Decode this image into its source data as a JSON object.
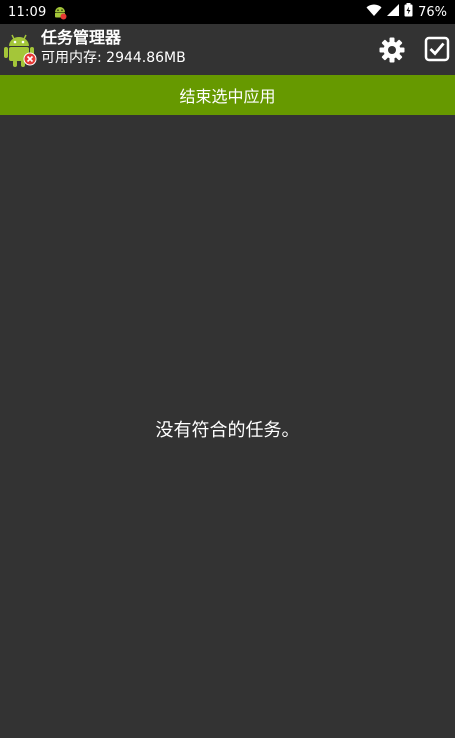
{
  "status_bar": {
    "time": "11:09",
    "battery_percent": "76%",
    "app_notification_icon": "android-icon",
    "wifi_icon": "wifi-icon",
    "signal_icon": "cell-signal-icon",
    "battery_icon": "battery-charging-icon"
  },
  "app_bar": {
    "title": "任务管理器",
    "subtitle": "可用内存: 2944.86MB",
    "app_icon": "android-task-killer-icon",
    "settings_icon": "gear-icon",
    "select_all_icon": "checkbox-checked-icon"
  },
  "actions": {
    "end_selected_label": "结束选中应用"
  },
  "main": {
    "empty_message": "没有符合的任务。"
  },
  "colors": {
    "background": "#333333",
    "status_bar": "#000000",
    "accent_green": "#669900",
    "text": "#ffffff",
    "badge_red": "#e53935"
  }
}
